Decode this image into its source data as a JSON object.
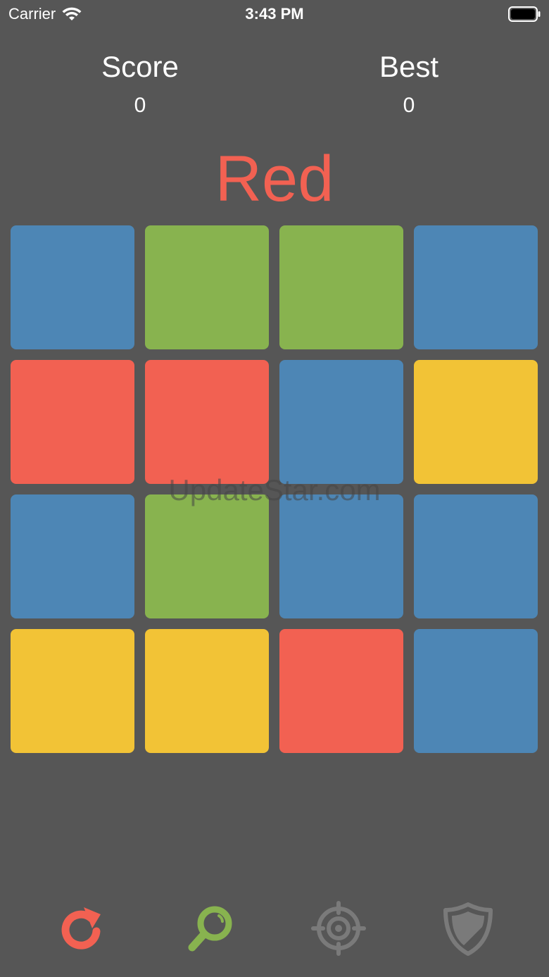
{
  "status_bar": {
    "carrier": "Carrier",
    "time": "3:43 PM"
  },
  "score": {
    "label": "Score",
    "value": "0"
  },
  "best": {
    "label": "Best",
    "value": "0"
  },
  "target": {
    "word": "Red",
    "color": "#f26152"
  },
  "colors": {
    "blue": "#4d86b5",
    "green": "#88b34f",
    "red": "#f26152",
    "yellow": "#f2c336",
    "background": "#565656"
  },
  "grid": [
    [
      "blue",
      "green",
      "green",
      "blue"
    ],
    [
      "red",
      "red",
      "blue",
      "yellow"
    ],
    [
      "blue",
      "green",
      "blue",
      "blue"
    ],
    [
      "yellow",
      "yellow",
      "red",
      "blue"
    ]
  ],
  "watermark": "UpdateStar.com",
  "toolbar": [
    {
      "icon": "refresh-icon",
      "color": "#f26152"
    },
    {
      "icon": "magnifier-icon",
      "color": "#88b34f"
    },
    {
      "icon": "target-icon",
      "color": "#7a7a7a"
    },
    {
      "icon": "shield-icon",
      "color": "#7a7a7a"
    }
  ]
}
